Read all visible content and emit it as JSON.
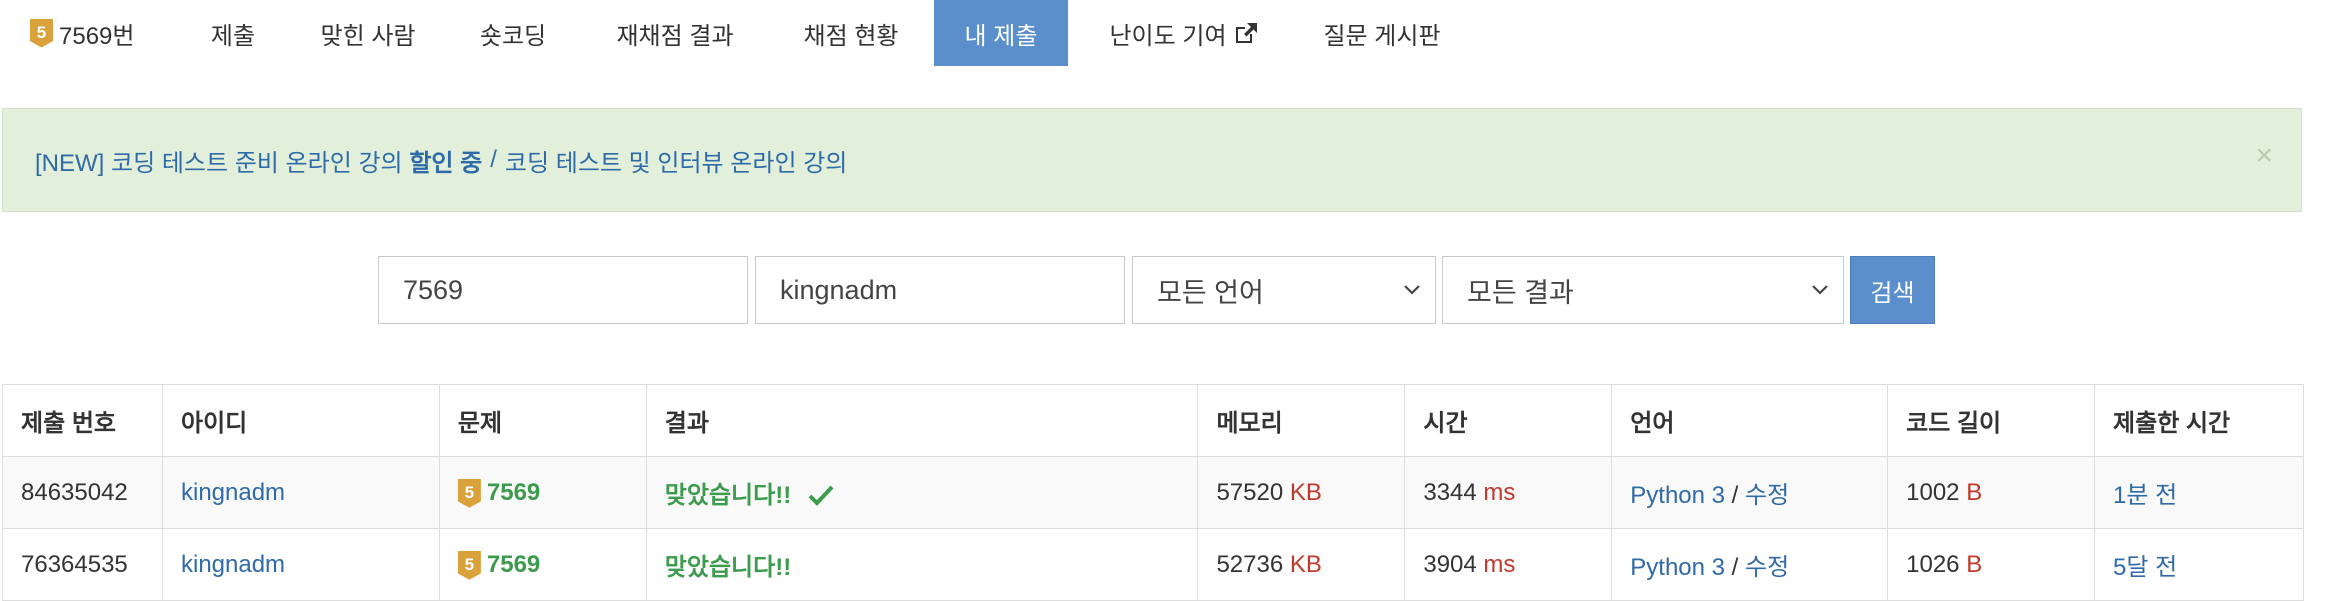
{
  "nav": {
    "problem_tier": "5",
    "problem_label": "7569번",
    "items": [
      "제출",
      "맞힌 사람",
      "숏코딩",
      "재채점 결과",
      "채점 현황",
      "내 제출",
      "난이도 기여",
      "질문 게시판"
    ],
    "external_icon": "external-link-icon"
  },
  "alert": {
    "prefix": "[NEW] 코딩 테스트 준비 온라인 강의",
    "highlight": "할인 중",
    "sep": "/",
    "suffix": "코딩 테스트 및 인터뷰 온라인 강의",
    "close": "×"
  },
  "search": {
    "problem_value": "7569",
    "user_value": "kingnadm",
    "language_selected": "모든 언어",
    "result_selected": "모든 결과",
    "button_label": "검색"
  },
  "table": {
    "headers": [
      "제출 번호",
      "아이디",
      "문제",
      "결과",
      "메모리",
      "시간",
      "언어",
      "코드 길이",
      "제출한 시간"
    ],
    "rows": [
      {
        "id": "84635042",
        "user": "kingnadm",
        "tier": "5",
        "problem": "7569",
        "result": "맞았습니다!!",
        "memory": "57520",
        "memory_unit": "KB",
        "time": "3344",
        "time_unit": "ms",
        "language": "Python 3",
        "lang_sep": "/",
        "edit": "수정",
        "length": "1002",
        "length_unit": "B",
        "submitted": "1분 전"
      },
      {
        "id": "76364535",
        "user": "kingnadm",
        "tier": "5",
        "problem": "7569",
        "result": "맞았습니다!!",
        "memory": "52736",
        "memory_unit": "KB",
        "time": "3904",
        "time_unit": "ms",
        "language": "Python 3",
        "lang_sep": "/",
        "edit": "수정",
        "length": "1026",
        "length_unit": "B",
        "submitted": "5달 전"
      }
    ]
  },
  "colors": {
    "accent": "#5a8fcc",
    "success": "#3d9b4e",
    "unit": "#c0392b",
    "link": "#2f6ba8",
    "alert_bg": "#e1efdb"
  }
}
